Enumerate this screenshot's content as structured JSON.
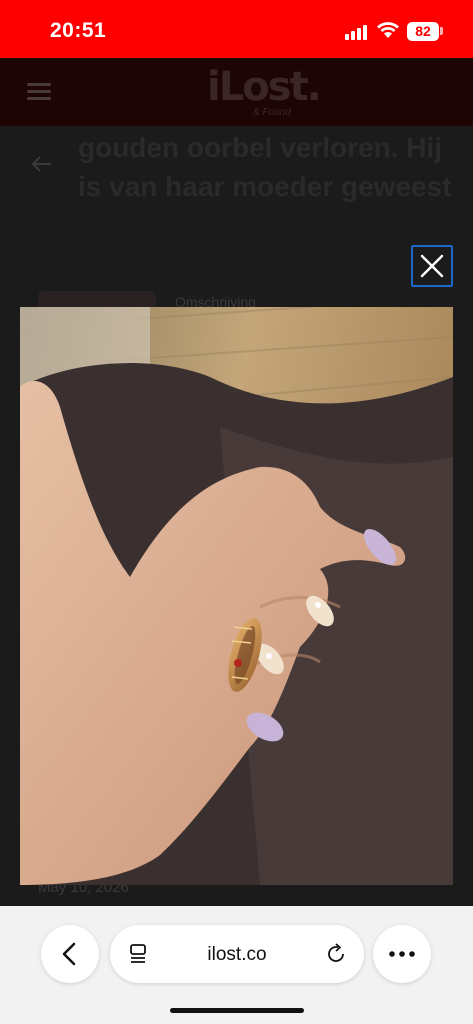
{
  "status_bar": {
    "time": "20:51",
    "battery": "82"
  },
  "header": {
    "logo": "iLost.",
    "logo_sub": "& Found"
  },
  "page": {
    "title": "gouden oorbel verloren. Hij is van haar moeder geweest",
    "description_label": "Omschrijving",
    "date": "May 10, 2026"
  },
  "browser": {
    "url": "ilost.co"
  },
  "colors": {
    "status_red": "#fe0000",
    "close_border": "#1e66c7"
  }
}
